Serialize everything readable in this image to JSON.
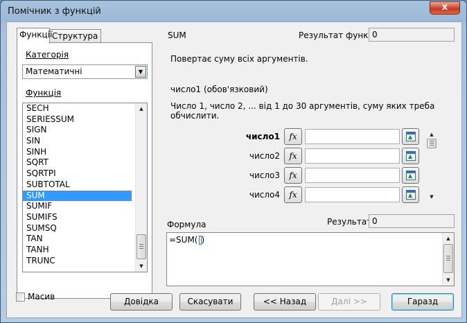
{
  "window": {
    "title": "Помічник з функцій",
    "close_glyph": "x"
  },
  "tabs": [
    {
      "label": "Функції",
      "active": true
    },
    {
      "label": "Структура",
      "active": false
    }
  ],
  "category": {
    "label": "Категорія",
    "value": "Математичні"
  },
  "function_list": {
    "label": "Функція",
    "items": [
      "SECH",
      "SERIESSUM",
      "SIGN",
      "SIN",
      "SINH",
      "SQRT",
      "SQRTPI",
      "SUBTOTAL",
      "SUM",
      "SUMIF",
      "SUMIFS",
      "SUMSQ",
      "TAN",
      "TANH",
      "TRUNC"
    ],
    "selected": "SUM"
  },
  "function_name": "SUM",
  "function_result": {
    "label": "Результат функції",
    "value": "0"
  },
  "description": "Повертає суму всіх аргументів.",
  "argument_title": "число1 (обов'язковий)",
  "argument_description": "Число 1, число 2, ... від 1 до 30 аргументів, суму яких треба обчислити.",
  "arguments": [
    {
      "label": "число1",
      "value": "",
      "bold": true
    },
    {
      "label": "число2",
      "value": "",
      "bold": false
    },
    {
      "label": "число3",
      "value": "",
      "bold": false
    },
    {
      "label": "число4",
      "value": "",
      "bold": false
    }
  ],
  "fx_glyph": "fx",
  "formula": {
    "label": "Формула",
    "value": "=SUM(",
    "closing": ")"
  },
  "result": {
    "label": "Результат",
    "value": "0"
  },
  "array_checkbox": {
    "label": "Масив",
    "checked": false
  },
  "buttons": {
    "help": "Довідка",
    "cancel": "Скасувати",
    "back": "<< Назад",
    "next": "Далі >>",
    "ok": "Гаразд"
  },
  "icons": {
    "scroll_up": "scroll-up-arrow-icon",
    "scroll_down": "scroll-down-arrow-icon",
    "shrink": "shrink-dialog-icon",
    "combo_arrow": "chevron-down-icon"
  }
}
